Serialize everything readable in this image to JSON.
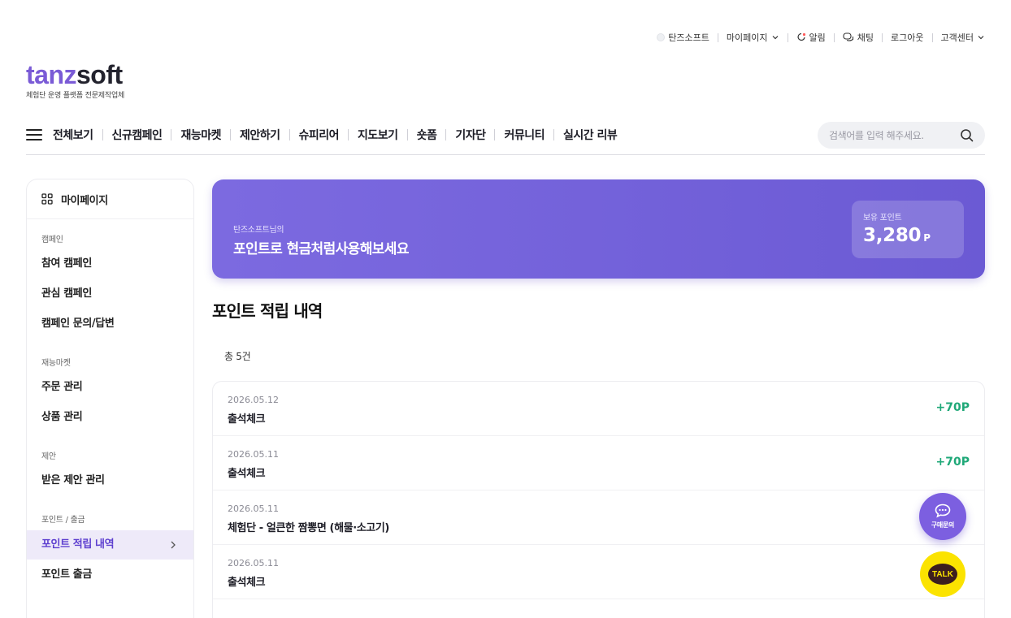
{
  "util": {
    "brand": "탄즈소프트",
    "mypage": "마이페이지",
    "alarm": "알림",
    "chat": "채팅",
    "logout": "로그아웃",
    "support": "고객센터"
  },
  "logo": {
    "part1": "tanz",
    "part2": "soft",
    "tagline": "체험단 운영 플랫폼 전문제작업체"
  },
  "nav": {
    "items": [
      "전체보기",
      "신규캠페인",
      "재능마켓",
      "제안하기",
      "슈피리어",
      "지도보기",
      "숏폼",
      "기자단",
      "커뮤니티",
      "실시간 리뷰"
    ],
    "search_placeholder": "검색어를 입력 해주세요."
  },
  "sidebar": {
    "title": "마이페이지",
    "sections": [
      {
        "label": "캠페인",
        "items": [
          "참여 캠페인",
          "관심 캠페인",
          "캠페인 문의/답변"
        ]
      },
      {
        "label": "재능마켓",
        "items": [
          "주문 관리",
          "상품 관리"
        ]
      },
      {
        "label": "제안",
        "items": [
          "받은 제안 관리"
        ]
      },
      {
        "label": "포인트 / 출금",
        "items": [
          "포인트 적립 내역",
          "포인트 출금"
        ]
      }
    ],
    "active_item": "포인트 적립 내역"
  },
  "banner": {
    "sub": "탄즈소프트님의",
    "main": "포인트로 현금처럼사용해보세요",
    "points_label": "보유 포인트",
    "points_value": "3,280",
    "points_unit": "P"
  },
  "page": {
    "title": "포인트 적립 내역",
    "count": "총 5건"
  },
  "records": [
    {
      "date": "2026.05.12",
      "title": "출석체크",
      "amount": "+70P"
    },
    {
      "date": "2026.05.11",
      "title": "출석체크",
      "amount": "+70P"
    },
    {
      "date": "2026.05.11",
      "title": "체험단 - 얼큰한 짬뽕면 (해물·소고기)",
      "amount": ""
    },
    {
      "date": "2026.05.11",
      "title": "출석체크",
      "amount": ""
    }
  ],
  "floating": {
    "inquiry_label": "구매문의",
    "talk_label": "TALK"
  },
  "colors": {
    "brand_purple": "#7a5bd6",
    "banner": "#7468dc",
    "positive": "#1fa878",
    "kakao": "#fbe300"
  }
}
